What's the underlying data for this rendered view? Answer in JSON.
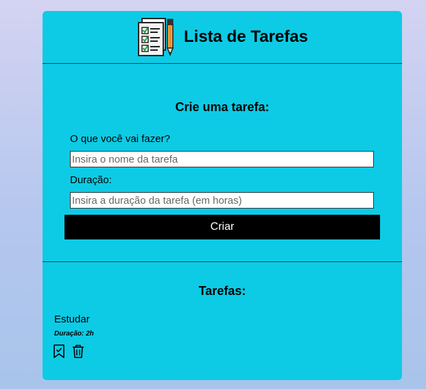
{
  "header": {
    "title": "Lista de Tarefas",
    "logo_icon": "checklist-clipboard-pencil-icon"
  },
  "form": {
    "title": "Crie uma tarefa:",
    "name_label": "O que você vai fazer?",
    "name_placeholder": "Insira o nome da tarefa",
    "name_value": "",
    "duration_label": "Duração:",
    "duration_placeholder": "Insira a duração da tarefa (em horas)",
    "duration_value": "",
    "submit_label": "Criar"
  },
  "tasks": {
    "title": "Tarefas:",
    "items": [
      {
        "name": "Estudar",
        "duration": "Duração: 2h",
        "complete_icon": "bookmark-check-icon",
        "delete_icon": "trash-icon"
      }
    ]
  },
  "colors": {
    "card_background": "#0dcbe5",
    "button_background": "#000000",
    "button_text": "#ffffff"
  }
}
